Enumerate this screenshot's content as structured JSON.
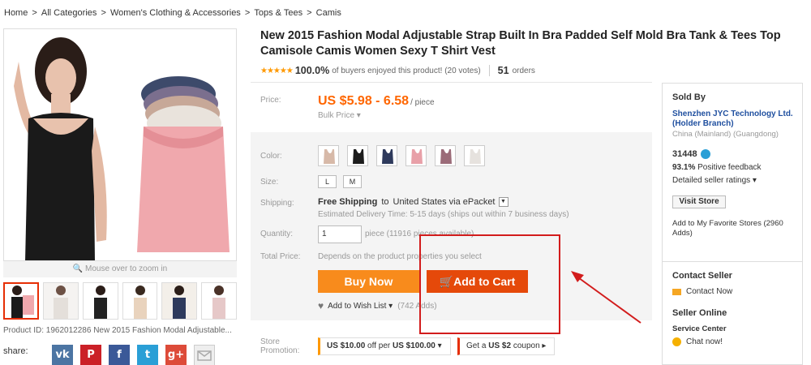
{
  "breadcrumb": [
    "Home",
    "All Categories",
    "Women's Clothing & Accessories",
    "Tops & Tees",
    "Camis"
  ],
  "breadcrumb_sep": ">",
  "gallery": {
    "zoom_hint": "Mouse over to zoom in",
    "product_id_text": "Product ID: 1962012286 New 2015 Fashion Modal Adjustable..."
  },
  "share": {
    "label": "share:",
    "icons": [
      "vk",
      "P",
      "f",
      "t",
      "g+",
      "mail"
    ]
  },
  "product": {
    "title": "New 2015 Fashion Modal Adjustable Strap Built In Bra Padded Self Mold Bra Tank & Tees Top Camisole Camis Women Sexy T Shirt Vest",
    "stars": "★★★★★",
    "rating_pct": "100.0%",
    "rating_text": "of buyers enjoyed this product! (20 votes)",
    "orders_num": "51",
    "orders_label": "orders"
  },
  "price": {
    "label": "Price:",
    "value": "US $5.98 - 6.58",
    "unit": "/ piece",
    "bulk": "Bulk Price ▾"
  },
  "props": {
    "color_label": "Color:",
    "colors": [
      "#d7b9a8",
      "#1c1c1c",
      "#2e3a5c",
      "#e8a0a8",
      "#9b6b78",
      "#e6e2de"
    ],
    "size_label": "Size:",
    "sizes": [
      "L",
      "M"
    ],
    "shipping_label": "Shipping:",
    "shipping_free": "Free Shipping",
    "shipping_to": "to",
    "shipping_dest": "United States via ePacket",
    "delivery": "Estimated Delivery Time: 5-15 days (ships out within 7 business days)",
    "quantity_label": "Quantity:",
    "quantity_value": "1",
    "quantity_info": "piece (11916 pieces available)",
    "total_label": "Total Price:",
    "total_value": "Depends on the product properties you select",
    "buy_now": "Buy Now",
    "add_to_cart": "Add to Cart",
    "wish_label": "Add to Wish List ▾",
    "wish_adds": "(742 Adds)"
  },
  "promotion": {
    "label": "Store Promotion:",
    "promo1_prefix": "US $10.00",
    "promo1_mid": "off per",
    "promo1_bold": "US $100.00",
    "promo2_text": "Get a",
    "promo2_bold": "US $2",
    "promo2_suffix": "coupon"
  },
  "seller": {
    "sold_by": "Sold By",
    "store_name": "Shenzhen JYC Technology Ltd. (Holder Branch)",
    "location": "China (Mainland) (Guangdong)",
    "score": "31448",
    "positive_pct": "93.1%",
    "positive_label": "Positive feedback",
    "detailed": "Detailed seller ratings ▾",
    "visit": "Visit Store",
    "favorite": "Add to My Favorite Stores (2960 Adds)",
    "contact_title": "Contact Seller",
    "contact_now": "Contact Now",
    "online_title": "Seller Online",
    "service_center": "Service Center",
    "chat_now": "Chat now!"
  },
  "colors": {
    "price": "#ff6600",
    "buy_now": "#f88b1c",
    "add_to_cart": "#e5490a",
    "annotation": "#d21c1c",
    "link": "#1f4f9f"
  }
}
